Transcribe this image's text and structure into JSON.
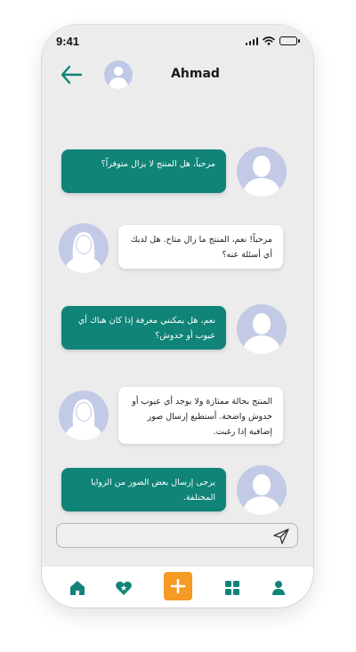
{
  "status_bar": {
    "time": "9:41"
  },
  "header": {
    "title": "Ahmad"
  },
  "messages": [
    {
      "side": "sent",
      "text": "مرحباً، هل المنتج لا يزال متوفراً؟"
    },
    {
      "side": "received",
      "text": "مرحباً! نعم، المنتج ما زال متاح. هل لديك أي أسئلة عنه؟"
    },
    {
      "side": "sent",
      "text": "نعم، هل يمكنني معرفة إذا كان هناك أي عيوب أو خدوش؟"
    },
    {
      "side": "received",
      "text": "المنتج بحالة ممتازة ولا يوجد أي عيوب أو خدوش واضحة. أستطيع إرسال صور إضافية إذا رغبت."
    },
    {
      "side": "sent",
      "text": "يرجى إرسال بعض الصور من الزوايا المختلفة."
    }
  ],
  "composer": {
    "value": "",
    "placeholder": ""
  },
  "colors": {
    "accent": "#0f8477",
    "action": "#f59a23",
    "avatar": "#c3cae6",
    "icon": "#0f8477"
  },
  "tabs": [
    "home-icon",
    "heart-star-icon",
    "add-icon",
    "grid-icon",
    "profile-icon"
  ]
}
